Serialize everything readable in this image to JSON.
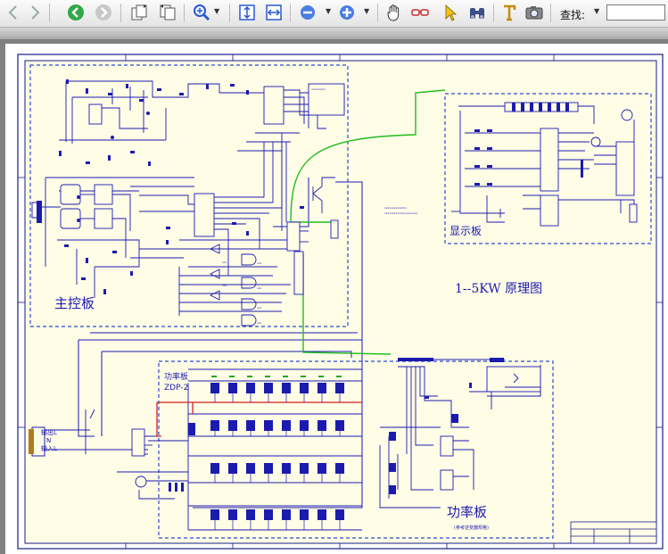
{
  "toolbar": {
    "find_label": "查找:",
    "find_value": "",
    "icons": [
      "back-arrow-icon",
      "forward-arrow-icon",
      "previous-page-icon",
      "next-page-icon",
      "rotate-page-icon",
      "rotate-page-icon",
      "zoom-in-icon",
      "fit-page-icon",
      "fit-width-icon",
      "zoom-out-icon",
      "zoom-in-icon",
      "hand-tool-icon",
      "reading-glasses-icon",
      "select-arrow-icon",
      "binoculars-icon",
      "text-select-icon",
      "snapshot-camera-icon"
    ]
  },
  "schematic": {
    "main_board_label": "主控板",
    "display_board_label": "显示板",
    "title_label": "1--5KW 原理图",
    "power_board_label": "功率板",
    "power_board_sub_label": "功率板",
    "power_board_model": "ZDP-2",
    "power_board_note": "(参考逆变器规格)",
    "input_output_labels": [
      "输出L",
      "N",
      "输入L"
    ],
    "colors": {
      "schematic_blue": "#1b1bb0",
      "wire_green": "#22bb22",
      "wire_red": "#d42020",
      "paper": "#fffde6",
      "frame_blue": "#2a4ccf"
    }
  }
}
